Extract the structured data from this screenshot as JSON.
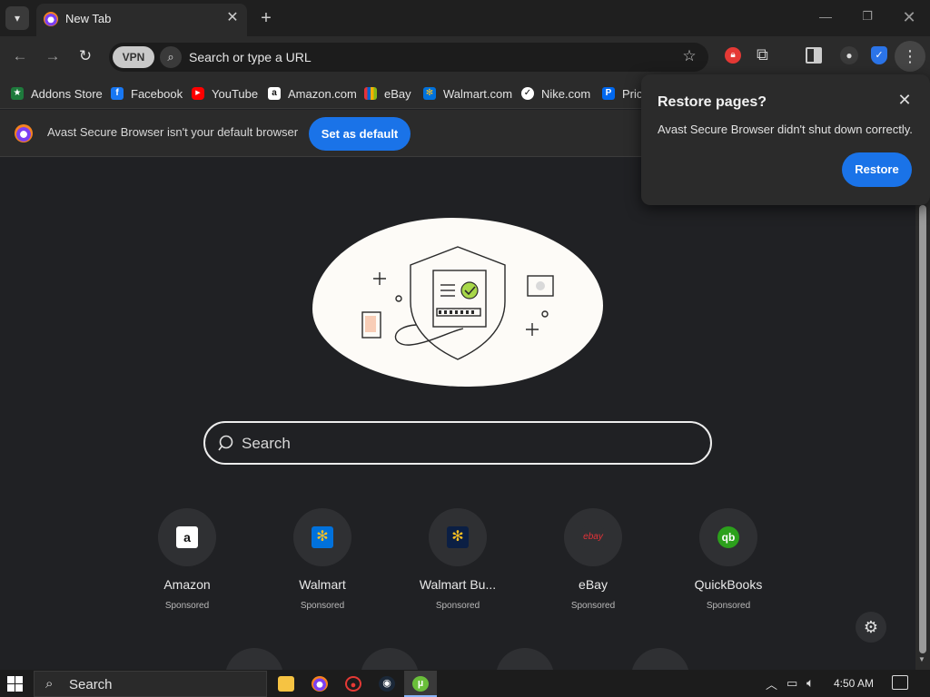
{
  "browser": {
    "tab": {
      "title": "New Tab"
    },
    "omnibox": {
      "vpn_label": "VPN",
      "placeholder": "Search or type a URL"
    }
  },
  "bookmarks": [
    {
      "label": "Addons Store",
      "icon": "addons-store-icon",
      "color": "#1e7a3c"
    },
    {
      "label": "Facebook",
      "icon": "facebook-icon",
      "color": "#1877f2"
    },
    {
      "label": "YouTube",
      "icon": "youtube-icon",
      "color": "#ff0000"
    },
    {
      "label": "Amazon.com",
      "icon": "amazon-icon",
      "color": "#ffffff"
    },
    {
      "label": "eBay",
      "icon": "ebay-icon",
      "color": "#e53238"
    },
    {
      "label": "Walmart.com",
      "icon": "walmart-icon",
      "color": "#0071dc"
    },
    {
      "label": "Nike.com",
      "icon": "nike-icon",
      "color": "#ffffff"
    },
    {
      "label": "Pric",
      "icon": "priceline-icon",
      "color": "#0068ef"
    }
  ],
  "infobar": {
    "message": "Avast Secure Browser isn't your default browser",
    "button_label": "Set as default"
  },
  "popup": {
    "title": "Restore pages?",
    "message": "Avast Secure Browser didn't shut down correctly.",
    "button_label": "Restore"
  },
  "newtab": {
    "search_placeholder": "Search",
    "tiles": [
      {
        "name": "Amazon",
        "badge": "Sponsored",
        "logo_text": "a",
        "logo_bg": "#ffffff",
        "logo_fg": "#111111"
      },
      {
        "name": "Walmart",
        "badge": "Sponsored",
        "logo_text": "✻",
        "logo_bg": "#0071dc",
        "logo_fg": "#ffc220"
      },
      {
        "name": "Walmart Bu...",
        "badge": "Sponsored",
        "logo_text": "✻",
        "logo_bg": "#0b1f44",
        "logo_fg": "#ffc220"
      },
      {
        "name": "eBay",
        "badge": "Sponsored",
        "logo_text": "ebay",
        "logo_bg": "#2f3033",
        "logo_fg": "#e53238"
      },
      {
        "name": "QuickBooks",
        "badge": "Sponsored",
        "logo_text": "qb",
        "logo_bg": "#2ca01c",
        "logo_fg": "#ffffff"
      }
    ]
  },
  "taskbar": {
    "search_placeholder": "Search",
    "clock": "4:50 AM"
  },
  "colors": {
    "accent": "#1a73e8",
    "background": "#202124",
    "chrome": "#2b2b2b"
  }
}
